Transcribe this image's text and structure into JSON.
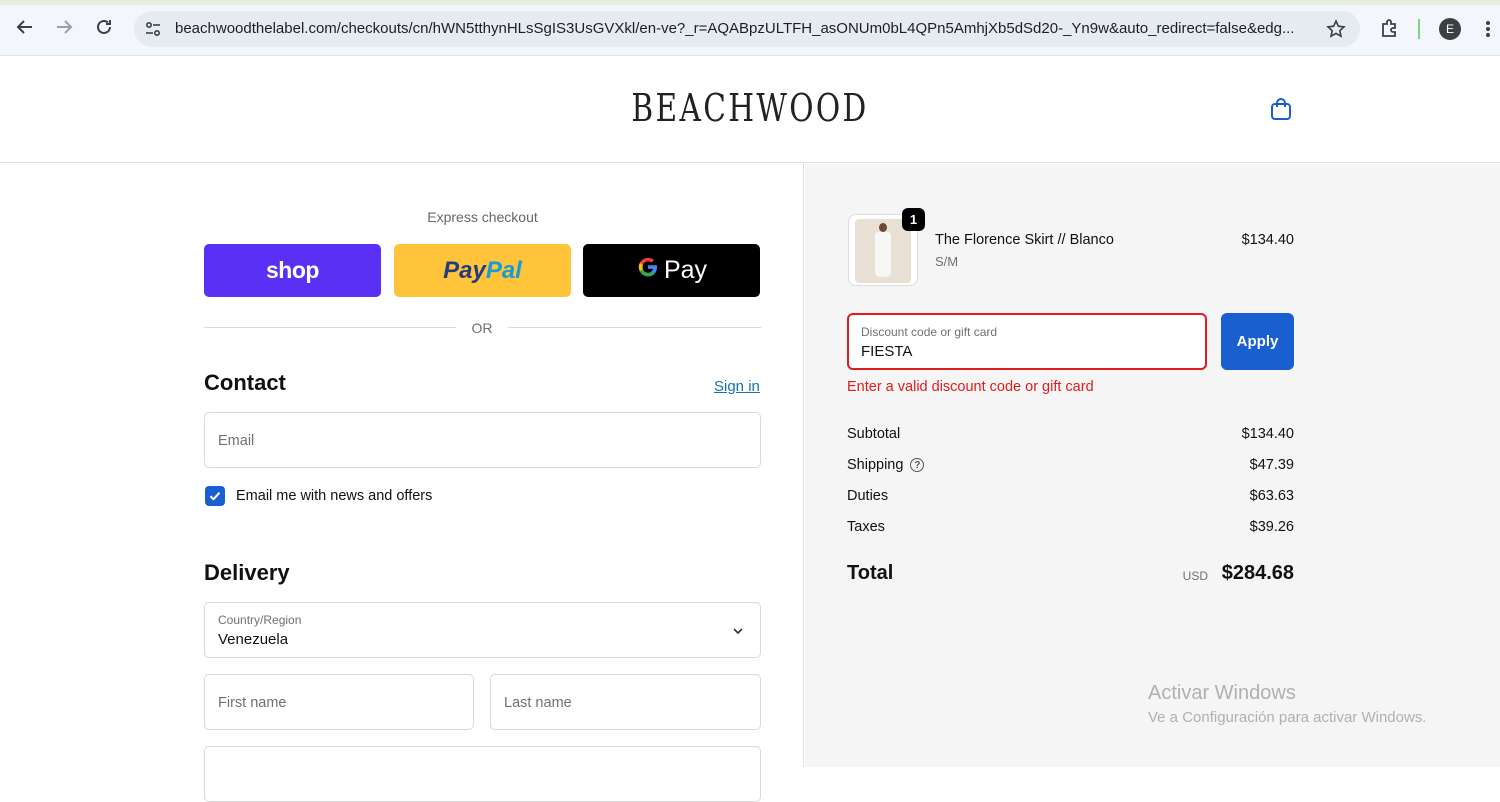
{
  "browser": {
    "url": "beachwoodthelabel.com/checkouts/cn/hWN5tthynHLsSgIS3UsGVXkl/en-ve?_r=AQABpzULTFH_asONUm0bL4QPn5AmhjXb5dSd20-_Yn9w&auto_redirect=false&edg...",
    "profile_initial": "E"
  },
  "header": {
    "logo": "BEACHWOOD"
  },
  "express": {
    "title": "Express checkout",
    "shop_label": "shop",
    "paypal_label_1": "Pay",
    "paypal_label_2": "Pal",
    "gpay_g": "G",
    "gpay_label": "Pay",
    "or_label": "OR"
  },
  "contact": {
    "title": "Contact",
    "sign_in": "Sign in",
    "email_placeholder": "Email",
    "newsletter_label": "Email me with news and offers",
    "newsletter_checked": true
  },
  "delivery": {
    "title": "Delivery",
    "country_label": "Country/Region",
    "country_value": "Venezuela",
    "first_name_placeholder": "First name",
    "last_name_placeholder": "Last name"
  },
  "order": {
    "item_name": "The Florence Skirt // Blanco",
    "item_variant": "S/M",
    "item_price": "$134.40",
    "item_qty": "1",
    "discount_label": "Discount code or gift card",
    "discount_value": "FIESTA",
    "apply_label": "Apply",
    "error": "Enter a valid discount code or gift card",
    "subtotal_label": "Subtotal",
    "subtotal": "$134.40",
    "shipping_label": "Shipping",
    "shipping": "$47.39",
    "duties_label": "Duties",
    "duties": "$63.63",
    "taxes_label": "Taxes",
    "taxes": "$39.26",
    "total_label": "Total",
    "currency": "USD",
    "total": "$284.68"
  },
  "watermark": {
    "line1": "Activar Windows",
    "line2": "Ve a Configuración para activar Windows."
  },
  "colors": {
    "accent": "#1a5fd0",
    "error": "#dd1d1d",
    "shop": "#5a31f4",
    "paypal": "#ffc439"
  }
}
